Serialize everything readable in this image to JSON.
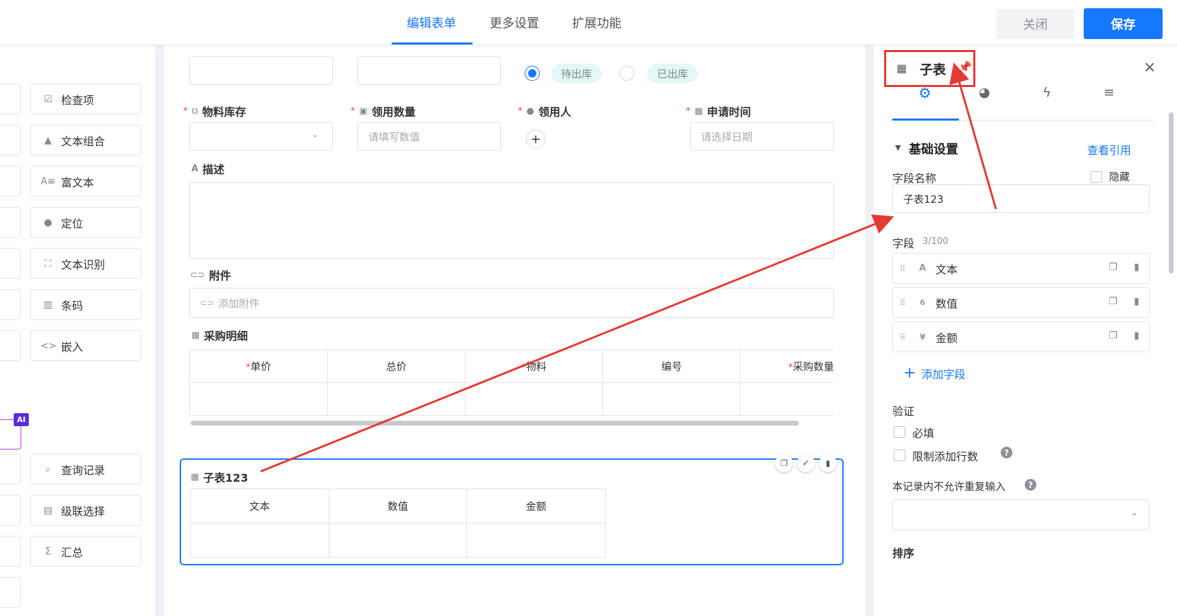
{
  "header": {
    "tabs": [
      {
        "label": "编辑表单"
      },
      {
        "label": "更多设置"
      },
      {
        "label": "扩展功能"
      }
    ],
    "close_label": "关闭",
    "save_label": "保存"
  },
  "components": [
    {
      "label": "检查项",
      "icon": "checkbox-icon"
    },
    {
      "label": "文本组合",
      "icon": "shapes-icon"
    },
    {
      "label": "富文本",
      "icon": "rich-text-icon"
    },
    {
      "label": "定位",
      "icon": "location-pin-icon"
    },
    {
      "label": "文本识别",
      "icon": "ocr-scan-icon"
    },
    {
      "label": "条码",
      "icon": "barcode-icon"
    },
    {
      "label": "嵌入",
      "icon": "code-brackets-icon"
    },
    {
      "label": "查询记录",
      "icon": "search-record-icon"
    },
    {
      "label": "级联选择",
      "icon": "cascade-icon"
    },
    {
      "label": "汇总",
      "icon": "sigma-icon"
    }
  ],
  "ai_badge": "AI",
  "form": {
    "row1_radio": {
      "option1": "待出库",
      "option2": "已出库",
      "selected": "待出库"
    },
    "material_stock": {
      "label": "物料库存",
      "required": true
    },
    "quantity": {
      "label": "领用数量",
      "placeholder": "请填写数值",
      "required": true
    },
    "recipient": {
      "label": "领用人",
      "required": true,
      "add_symbol": "+"
    },
    "apply_time": {
      "label": "申请时间",
      "placeholder": "请选择日期",
      "required": true
    },
    "description": {
      "label": "描述"
    },
    "attachment": {
      "label": "附件",
      "placeholder": "添加附件"
    },
    "purchase_detail": {
      "label": "采购明细",
      "columns": [
        {
          "label": "单价",
          "required": true
        },
        {
          "label": "总价",
          "required": false
        },
        {
          "label": "物料",
          "required": true
        },
        {
          "label": "编号",
          "required": false
        },
        {
          "label": "采购数量",
          "required": true
        }
      ]
    },
    "subtable": {
      "label": "子表123",
      "columns": [
        "文本",
        "数值",
        "金额"
      ]
    }
  },
  "settings": {
    "title": "子表",
    "section_title": "基础设置",
    "view_reference": "查看引用",
    "field_name_label": "字段名称",
    "hide_label": "隐藏",
    "field_name_value": "子表123",
    "fields_label": "字段",
    "fields_count": "3/100",
    "fields": [
      {
        "label": "文本",
        "type_icon": "A"
      },
      {
        "label": "数值",
        "type_icon": "6"
      },
      {
        "label": "金额",
        "type_icon": "¥"
      }
    ],
    "add_field": "添加字段",
    "validation_label": "验证",
    "required_label": "必填",
    "limit_rows_label": "限制添加行数",
    "no_duplicate_label": "本记录内不允许重复输入",
    "sort_label": "排序"
  },
  "colors": {
    "accent": "#1677ff",
    "annotation_red": "#e53935",
    "ai_purple": "#5a2cd8"
  }
}
